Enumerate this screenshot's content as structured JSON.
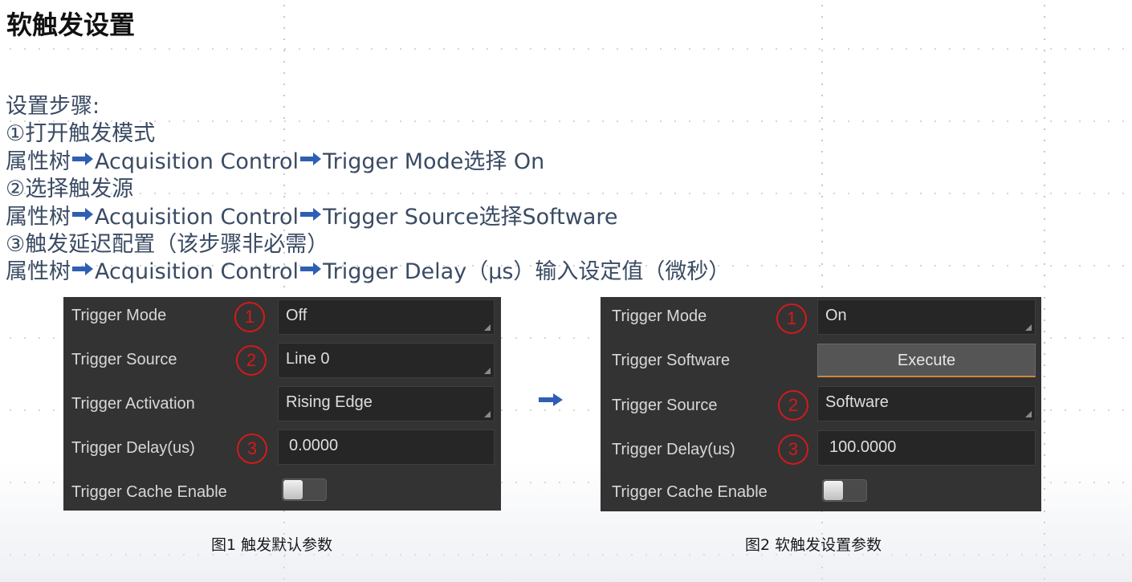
{
  "slide": {
    "title": "软触发设置",
    "steps": {
      "heading": "设置步骤:",
      "step1_title": "①打开触发模式",
      "step1_path": [
        "属性树",
        "Acquisition Control",
        "Trigger Mode选择 On"
      ],
      "step2_title": "②选择触发源",
      "step2_path": [
        "属性树",
        "Acquisition Control",
        "Trigger Source选择Software"
      ],
      "step3_title": "③触发延迟配置（该步骤非必需）",
      "step3_path": [
        "属性树",
        "Acquisition Control",
        "Trigger Delay（μs）输入设定值（微秒）"
      ]
    }
  },
  "panel_default": {
    "caption": "图1  触发默认参数",
    "rows": [
      {
        "label": "Trigger Mode",
        "marker": "1",
        "value": "Off"
      },
      {
        "label": "Trigger Source",
        "marker": "2",
        "value": "Line 0"
      },
      {
        "label": "Trigger Activation",
        "value": "Rising Edge"
      },
      {
        "label": "Trigger Delay(us)",
        "marker": "3",
        "value": "0.0000"
      },
      {
        "label": "Trigger Cache Enable"
      }
    ]
  },
  "panel_soft": {
    "caption": "图2  软触发设置参数",
    "rows": [
      {
        "label": "Trigger Mode",
        "marker": "1",
        "value": "On"
      },
      {
        "label": "Trigger Software",
        "button": "Execute"
      },
      {
        "label": "Trigger Source",
        "marker": "2",
        "value": "Software"
      },
      {
        "label": "Trigger Delay(us)",
        "marker": "3",
        "value": "100.0000"
      },
      {
        "label": "Trigger Cache Enable"
      }
    ]
  },
  "colors": {
    "arrow": "#2f5fb3",
    "marker": "#d41a1a",
    "panel_bg": "#333333",
    "step_text": "#3a4b63"
  },
  "icons": {
    "path_arrow": "right-arrow-icon",
    "panel_arrow": "right-arrow-icon"
  }
}
